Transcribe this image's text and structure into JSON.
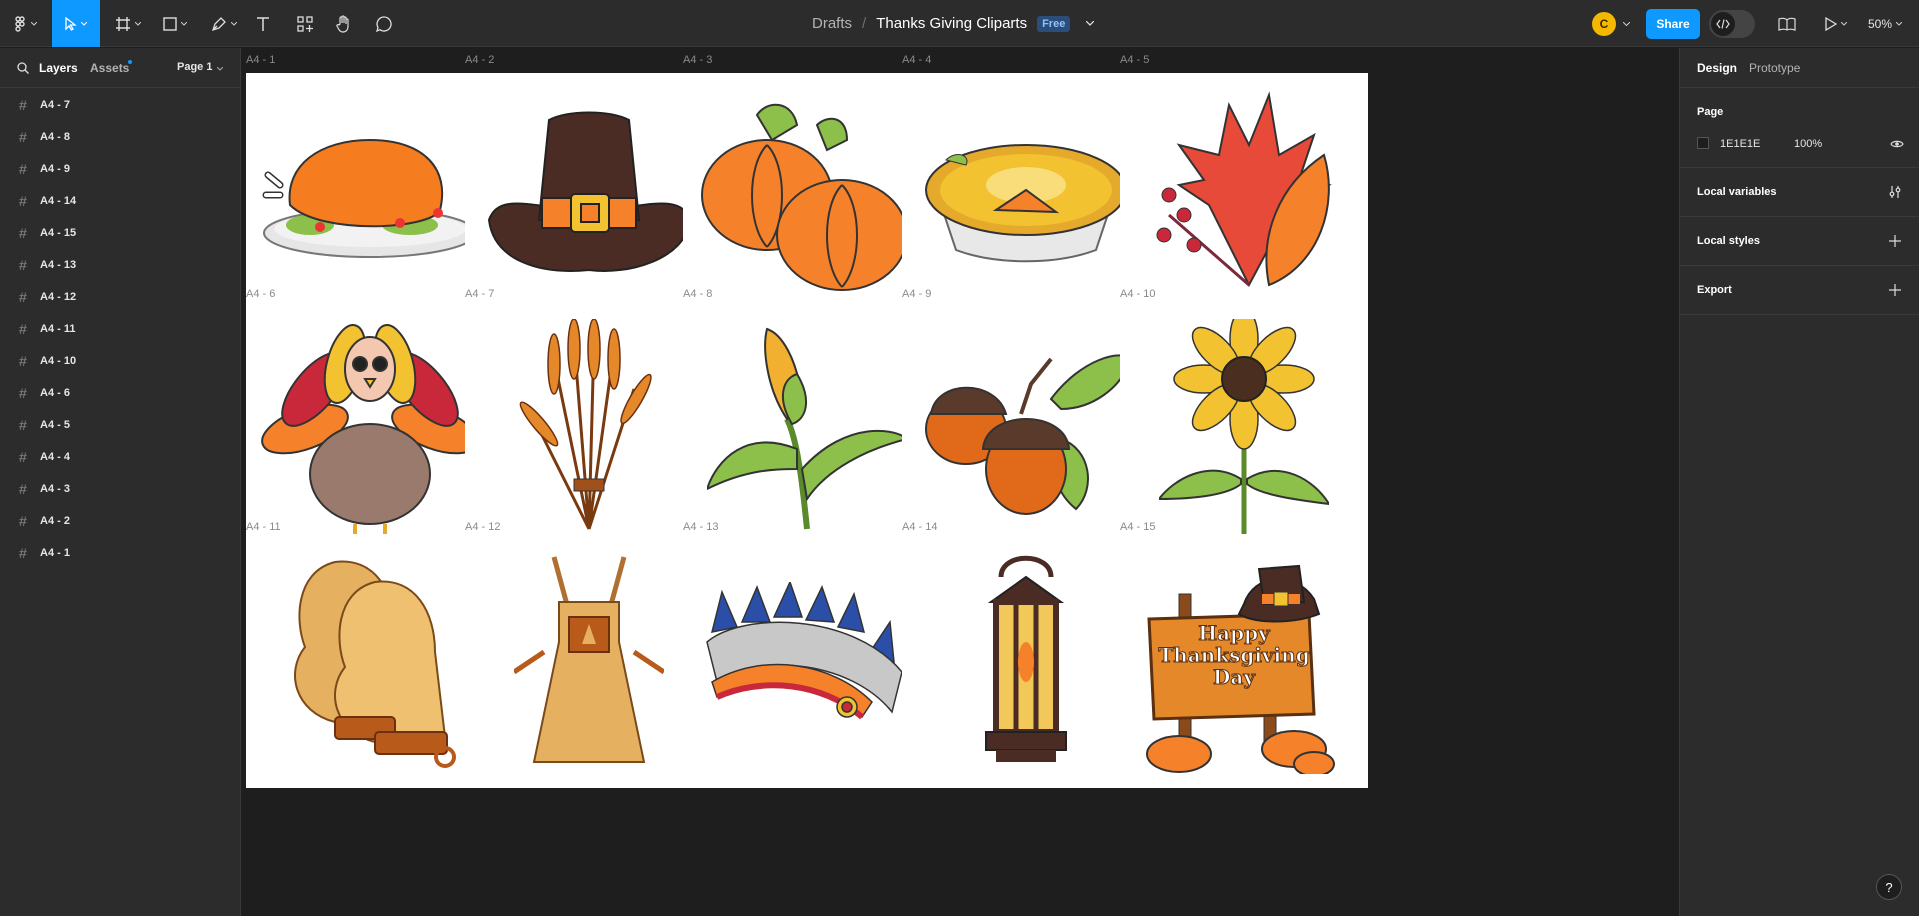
{
  "toolbar": {
    "breadcrumb_root": "Drafts",
    "breadcrumb_sep": "/",
    "file_title": "Thanks Giving Cliparts",
    "plan_badge": "Free",
    "share_label": "Share",
    "avatar_initial": "C",
    "zoom": "50%"
  },
  "left_panel": {
    "tab_layers": "Layers",
    "tab_assets": "Assets",
    "page_selector": "Page 1",
    "layers": [
      "A4 - 7",
      "A4 - 8",
      "A4 - 9",
      "A4 - 14",
      "A4 - 15",
      "A4 - 13",
      "A4 - 12",
      "A4 - 11",
      "A4 - 10",
      "A4 - 6",
      "A4 - 5",
      "A4 - 4",
      "A4 - 3",
      "A4 - 2",
      "A4 - 1"
    ]
  },
  "canvas": {
    "frames": [
      {
        "label": "A4 - 1",
        "clipart": "roast-turkey"
      },
      {
        "label": "A4 - 2",
        "clipart": "pilgrim-hat"
      },
      {
        "label": "A4 - 3",
        "clipart": "pumpkins"
      },
      {
        "label": "A4 - 4",
        "clipart": "pumpkin-pie"
      },
      {
        "label": "A4 - 5",
        "clipart": "autumn-leaves"
      },
      {
        "label": "A4 - 6",
        "clipart": "cartoon-turkey"
      },
      {
        "label": "A4 - 7",
        "clipart": "wheat-bundle"
      },
      {
        "label": "A4 - 8",
        "clipart": "corn"
      },
      {
        "label": "A4 - 9",
        "clipart": "acorns"
      },
      {
        "label": "A4 - 10",
        "clipart": "sunflower"
      },
      {
        "label": "A4 - 11",
        "clipart": "oven-mitts"
      },
      {
        "label": "A4 - 12",
        "clipart": "apron"
      },
      {
        "label": "A4 - 13",
        "clipart": "headdress"
      },
      {
        "label": "A4 - 14",
        "clipart": "lantern"
      },
      {
        "label": "A4 - 15",
        "clipart": "thanksgiving-sign",
        "sign_lines": [
          "Happy",
          "Thanksgiving",
          "Day"
        ]
      }
    ]
  },
  "right_panel": {
    "tab_design": "Design",
    "tab_prototype": "Prototype",
    "page_heading": "Page",
    "bg_color": "1E1E1E",
    "bg_opacity": "100%",
    "local_variables": "Local variables",
    "local_styles": "Local styles",
    "export": "Export"
  },
  "help": "?"
}
